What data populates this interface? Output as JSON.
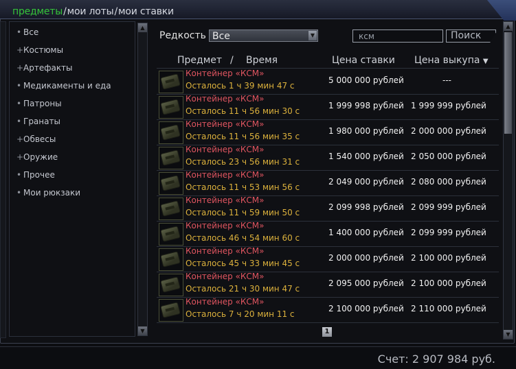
{
  "tabs": {
    "active": "предметы",
    "lots": "мои лоты",
    "bids": "мои ставки",
    "separator": "/"
  },
  "categories": [
    {
      "prefix": "•",
      "label": "Все"
    },
    {
      "prefix": "+",
      "label": "Костюмы"
    },
    {
      "prefix": "+",
      "label": "Артефакты"
    },
    {
      "prefix": "•",
      "label": "Медикаменты и еда"
    },
    {
      "prefix": "•",
      "label": "Патроны"
    },
    {
      "prefix": "•",
      "label": "Гранаты"
    },
    {
      "prefix": "+",
      "label": "Обвесы"
    },
    {
      "prefix": "+",
      "label": "Оружие"
    },
    {
      "prefix": "•",
      "label": "Прочее"
    },
    {
      "prefix": "•",
      "label": "Мои рюкзаки"
    }
  ],
  "filter": {
    "rarity_label": "Редкость",
    "rarity_value": "Все",
    "search_value": "ксм",
    "search_button": "Поиск"
  },
  "columns": {
    "item": "Предмет",
    "slash": "/",
    "time": "Время",
    "bid": "Цена ставки",
    "buyout": "Цена выкупа",
    "sort_indicator": "▼"
  },
  "rows": [
    {
      "name": "Контейнер «КСМ»",
      "time": "Осталось 1 ч 39 мин 47 с",
      "bid": "5 000 000 рублей",
      "buyout": "---"
    },
    {
      "name": "Контейнер «КСМ»",
      "time": "Осталось 11 ч 56 мин 30 с",
      "bid": "1 999 998 рублей",
      "buyout": "1 999 999 рублей"
    },
    {
      "name": "Контейнер «КСМ»",
      "time": "Осталось 11 ч 56 мин 35 с",
      "bid": "1 980 000 рублей",
      "buyout": "2 000 000 рублей"
    },
    {
      "name": "Контейнер «КСМ»",
      "time": "Осталось 23 ч 56 мин 31 с",
      "bid": "1 540 000 рублей",
      "buyout": "2 050 000 рублей"
    },
    {
      "name": "Контейнер «КСМ»",
      "time": "Осталось 11 ч 53 мин 56 с",
      "bid": "2 049 000 рублей",
      "buyout": "2 080 000 рублей"
    },
    {
      "name": "Контейнер «КСМ»",
      "time": "Осталось 11 ч 59 мин 50 с",
      "bid": "2 099 998 рублей",
      "buyout": "2 099 999 рублей"
    },
    {
      "name": "Контейнер «КСМ»",
      "time": "Осталось 46 ч 54 мин 60 с",
      "bid": "1 400 000 рублей",
      "buyout": "2 099 999 рублей"
    },
    {
      "name": "Контейнер «КСМ»",
      "time": "Осталось 45 ч 33 мин 45 с",
      "bid": "2 000 000 рублей",
      "buyout": "2 100 000 рублей"
    },
    {
      "name": "Контейнер «КСМ»",
      "time": "Осталось 21 ч 30 мин 47 с",
      "bid": "2 095 000 рублей",
      "buyout": "2 100 000 рублей"
    },
    {
      "name": "Контейнер «КСМ»",
      "time": "Осталось 7 ч 20 мин 11 с",
      "bid": "2 100 000 рублей",
      "buyout": "2 110 000 рублей"
    }
  ],
  "pagination": {
    "current_page": "1"
  },
  "balance": "Счет: 2 907 984 руб.",
  "icons": {
    "scroll_up": "chevron-up-icon",
    "scroll_down": "chevron-down-icon",
    "dropdown": "chevron-down-icon",
    "item_thumbnail": "container-icon"
  },
  "colors": {
    "active_tab": "#35c43a",
    "item_name": "#e05560",
    "time_remaining": "#dcb13c"
  }
}
